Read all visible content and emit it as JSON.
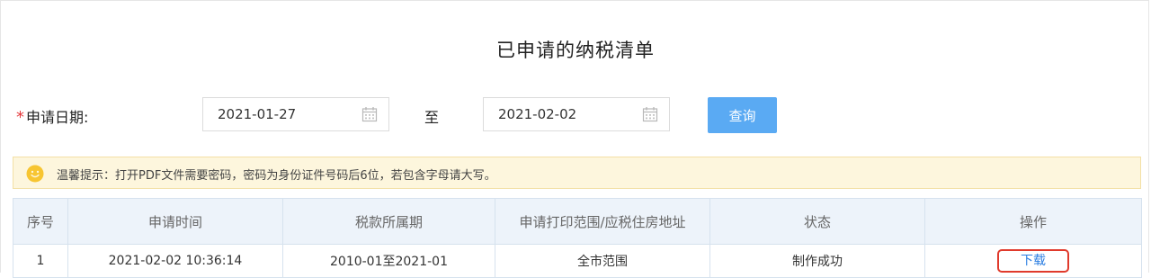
{
  "page": {
    "title": "已申请的纳税清单"
  },
  "query": {
    "required_mark": "*",
    "date_label": "申请日期:",
    "start_date": "2021-01-27",
    "to_label": "至",
    "end_date": "2021-02-02",
    "query_button": "查询"
  },
  "tip": {
    "icon": "smiley-icon",
    "text": "温馨提示：打开PDF文件需要密码，密码为身份证件号码后6位，若包含字母请大写。"
  },
  "table": {
    "headers": [
      "序号",
      "申请时间",
      "税款所属期",
      "申请打印范围/应税住房地址",
      "状态",
      "操作"
    ],
    "rows": [
      {
        "index": "1",
        "apply_time": "2021-02-02 10:36:14",
        "tax_period": "2010-01至2021-01",
        "scope": "全市范围",
        "status": "制作成功",
        "action": "下载"
      }
    ]
  },
  "colors": {
    "primary_button": "#5aaaf3",
    "link": "#2a7de1",
    "highlight_border": "#e03a2c",
    "required": "#e4393c",
    "tip_background": "#fdf6dd",
    "table_header_background": "#edf3fa"
  }
}
